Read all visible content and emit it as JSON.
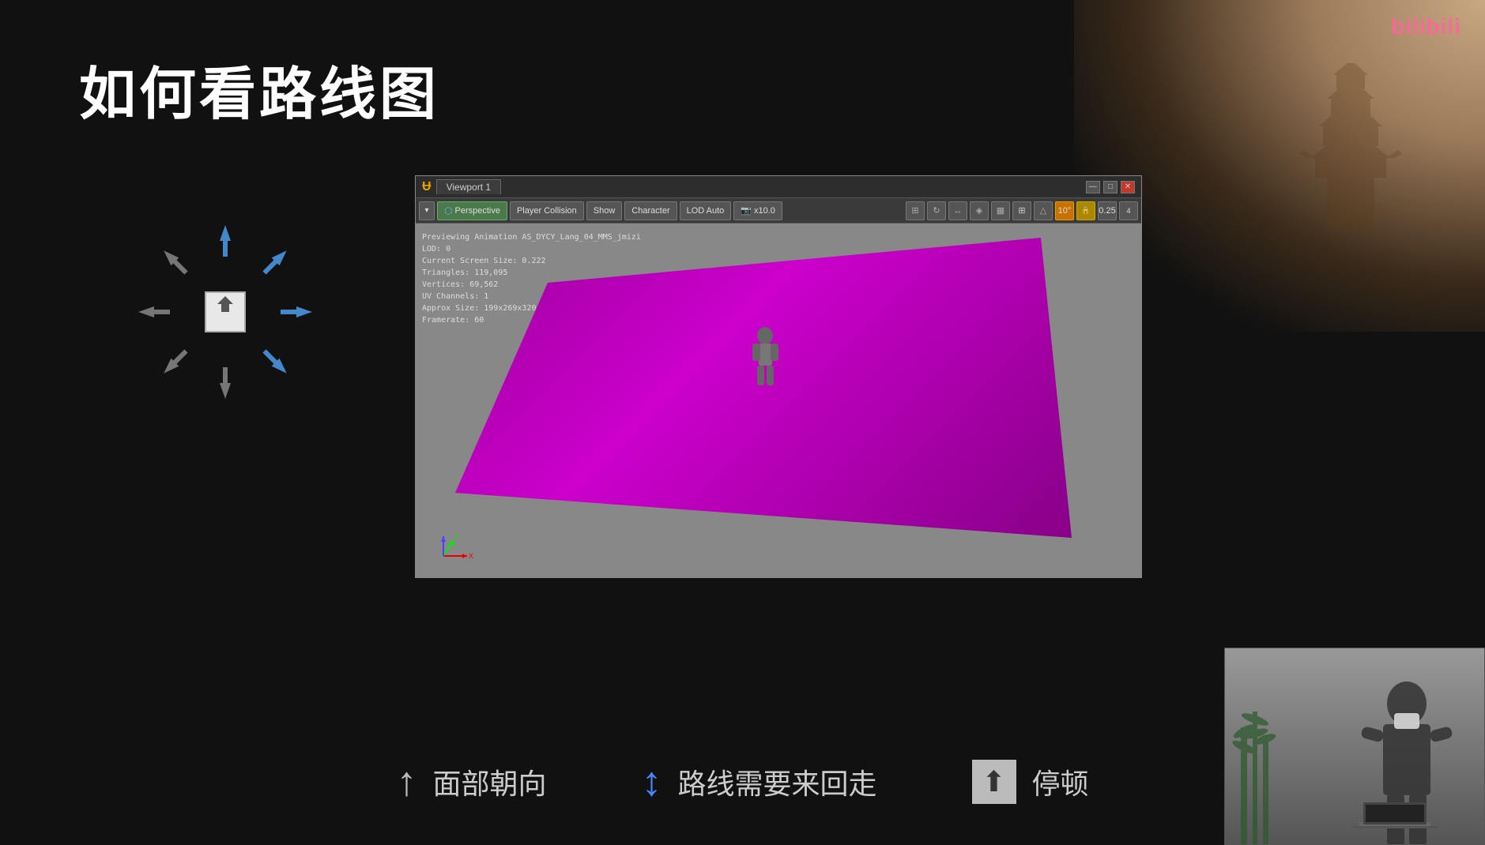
{
  "page": {
    "background_color": "#111111"
  },
  "title": "如何看路线图",
  "bilibili": {
    "logo_text": "bilibili"
  },
  "viewport": {
    "tab_label": "Viewport 1",
    "toolbar": {
      "dropdown_btn": "▾",
      "perspective_btn": "Perspective",
      "player_collision_btn": "Player Collision",
      "show_btn": "Show",
      "character_btn": "Character",
      "lod_auto_btn": "LOD Auto",
      "multiplier_btn": "x10.0",
      "degree_btn": "10°",
      "value_btn": "0.25",
      "icon_btn_4": "4"
    },
    "debug_info": {
      "line1": "Previewing Animation AS_DYCY_Lang_04_MMS_jmizi",
      "line2": "LOD: 0",
      "line3": "Current Screen Size: 0.222",
      "line4": "Triangles: 119,095",
      "line5": "Vertices: 69,562",
      "line6": "UV Channels: 1",
      "line7": "Approx Size: 199x269x320",
      "line8": "Framerate: 60"
    },
    "window_controls": {
      "minimize": "—",
      "maximize": "□",
      "close": "✕"
    }
  },
  "legend": {
    "item1": {
      "icon": "↑",
      "text": "面部朝向"
    },
    "item2": {
      "icon": "↕",
      "text": "路线需要来回走"
    },
    "item3": {
      "icon": "⇧",
      "text": "停顿"
    }
  }
}
